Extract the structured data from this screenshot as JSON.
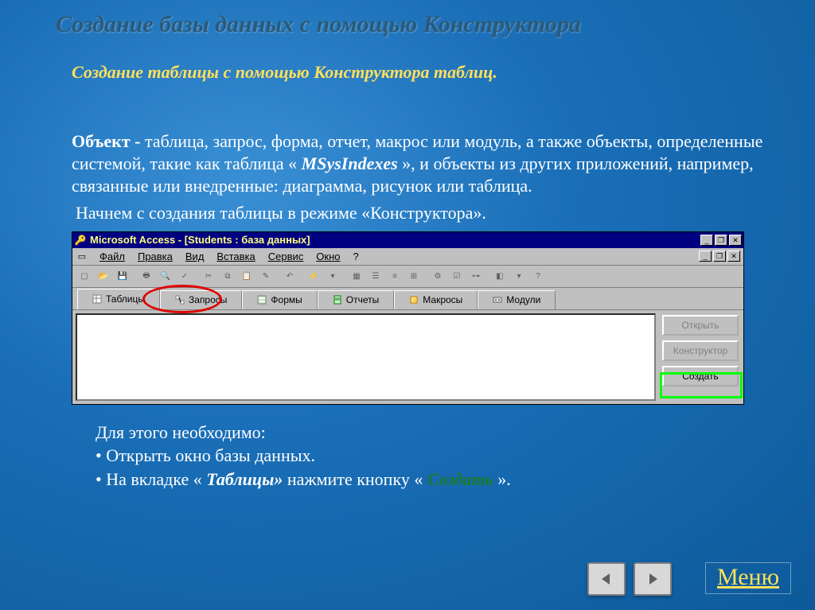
{
  "slide": {
    "title": "Создание базы данных с помощью Конструктора",
    "subtitle": "Создание таблицы с помощью Конструктора таблиц.",
    "paragraph_prefix": "Объект - ",
    "paragraph_body1": "таблица, запрос, форма, отчет, макрос или модуль, а также объекты, определенные системой, такие как таблица « ",
    "paragraph_msys": "MSysIndexes",
    "paragraph_body2": " », и объекты из других приложений, например, связанные или внедренные: диаграмма, рисунок или таблица.",
    "paragraph2": "Начнем с создания таблицы в режиме «Конструктора».",
    "footer_intro": "Для этого необходимо:",
    "footer_li1": "Открыть окно базы данных.",
    "footer_li2_a": "На вкладке « ",
    "footer_li2_tab": "Таблицы»",
    "footer_li2_b": " нажмите кнопку  « ",
    "footer_li2_btn": "Создать",
    "footer_li2_c": " ».",
    "menu_link": "Меню"
  },
  "access": {
    "title": "Microsoft Access - [Students : база данных]",
    "menu": {
      "file": "Файл",
      "edit": "Правка",
      "view": "Вид",
      "insert": "Вставка",
      "service": "Сервис",
      "window": "Окно",
      "help": "?"
    },
    "tabs": {
      "tables": "Таблицы",
      "queries": "Запросы",
      "forms": "Формы",
      "reports": "Отчеты",
      "macros": "Макросы",
      "modules": "Модули"
    },
    "buttons": {
      "open": "Открыть",
      "design": "Конструктор",
      "create": "Создать"
    }
  }
}
